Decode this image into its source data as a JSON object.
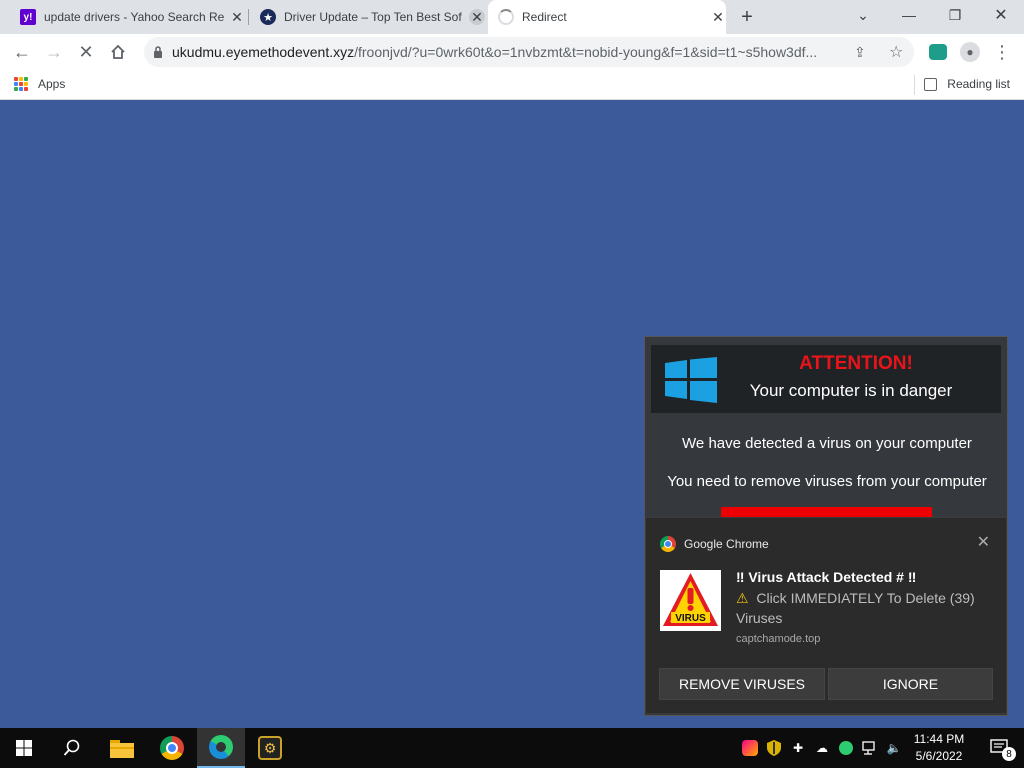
{
  "tabs": [
    {
      "title": "update drivers - Yahoo Search Re"
    },
    {
      "title": "Driver Update – Top Ten Best Sof"
    },
    {
      "title": "Redirect"
    }
  ],
  "toolbar": {
    "url_host": "ukudmu.eyemethodevent.xyz",
    "url_path": "/froonjvd/?u=0wrk60t&o=1nvbzmt&t=nobid-young&f=1&sid=t1~s5how3df..."
  },
  "bookmarks": {
    "apps_label": "Apps",
    "reading_list_label": "Reading list"
  },
  "scam_popup": {
    "attention": "ATTENTION!",
    "danger": "Your computer is in danger",
    "line1": "We have detected a virus on your computer",
    "line2": "You need to remove viruses from your computer"
  },
  "notification": {
    "app": "Google Chrome",
    "title": "‼ Virus Attack Detected # ‼",
    "body": "Click IMMEDIATELY To Delete (39) Viruses",
    "source": "captchamode.top",
    "virus_label": "VIRUS",
    "remove_button": "REMOVE VIRUSES",
    "ignore_button": "IGNORE"
  },
  "taskbar": {
    "time": "11:44 PM",
    "date": "5/6/2022",
    "notification_count": "8"
  },
  "colors": {
    "page_bg": "#3c5a9a",
    "attention_red": "#e8141a",
    "windows_blue": "#1ba1e2"
  }
}
